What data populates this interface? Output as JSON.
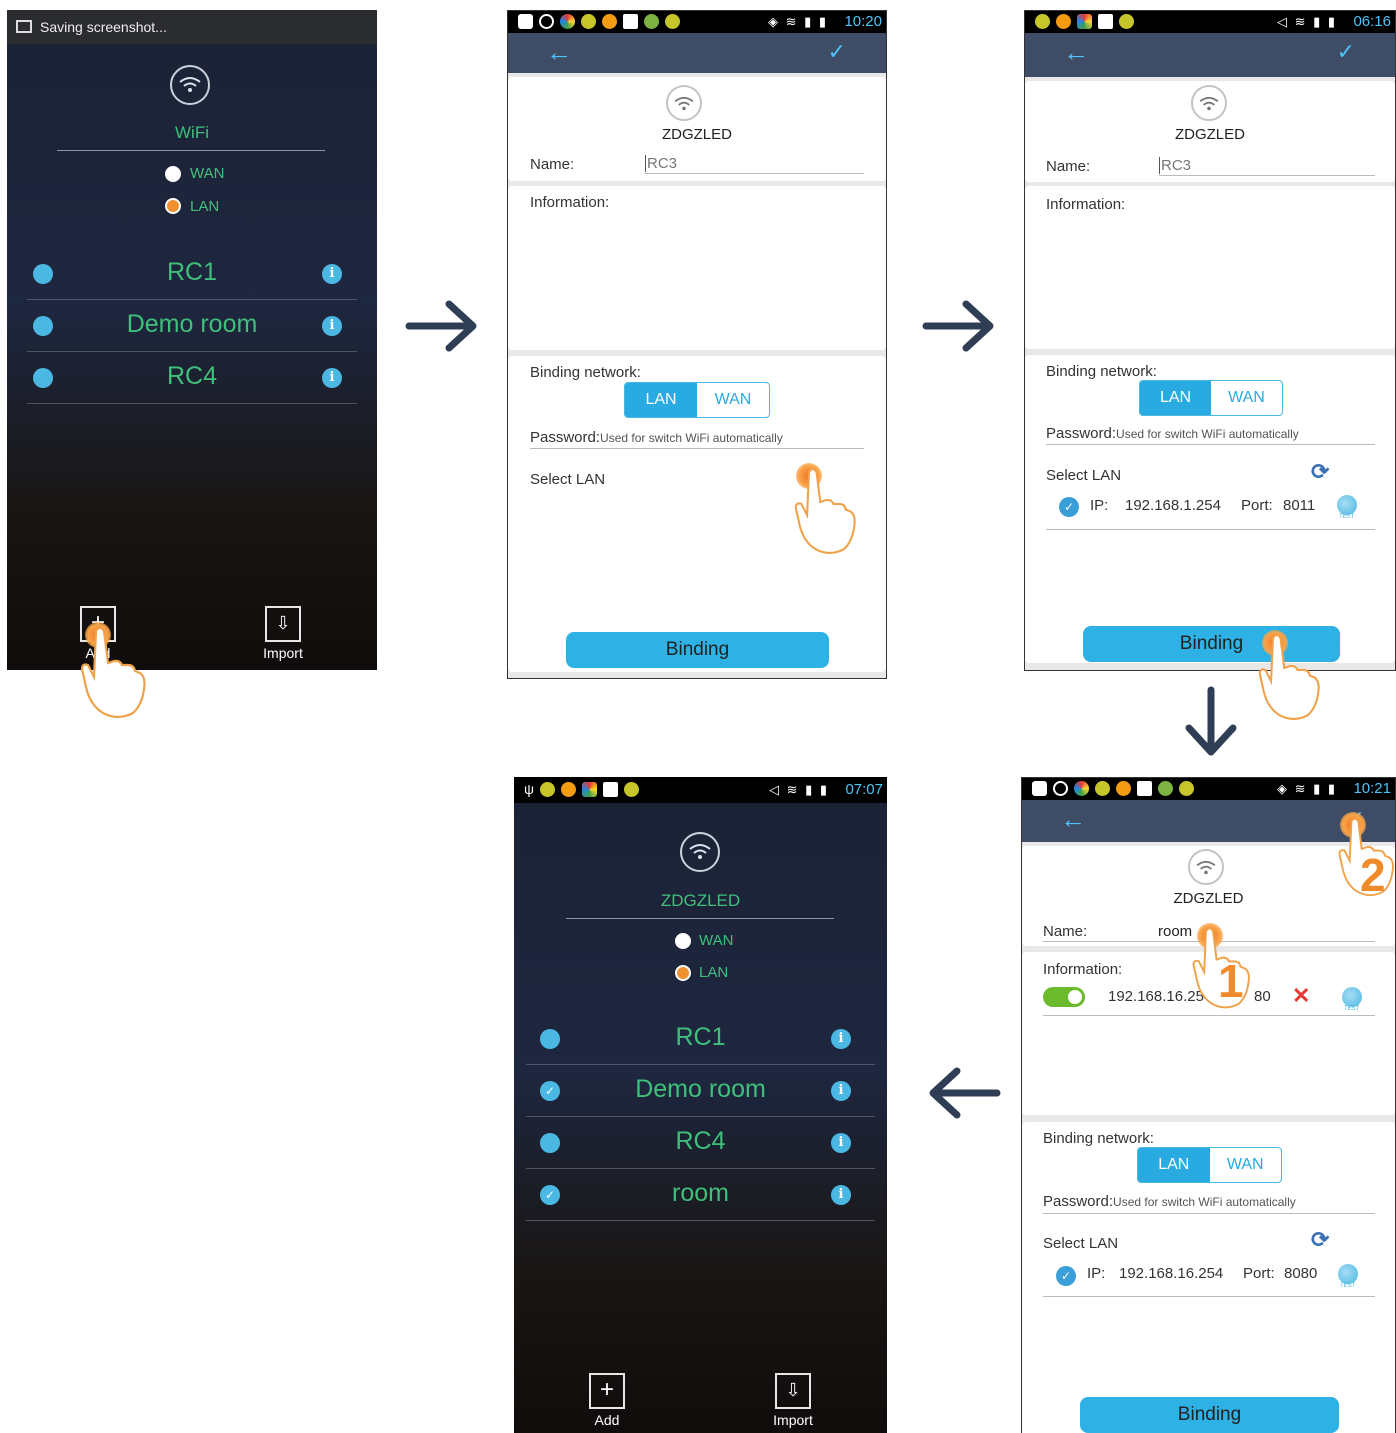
{
  "screen1": {
    "notification": "Saving screenshot...",
    "brand": "WiFi",
    "radio_wan": "WAN",
    "radio_lan": "LAN",
    "rows": [
      "RC1",
      "Demo room",
      "RC4"
    ],
    "add_label": "Add",
    "import_label": "Import"
  },
  "screen2": {
    "time": "10:20",
    "device": "ZDGZLED",
    "name_label": "Name:",
    "name_value": "RC3",
    "information_label": "Information:",
    "binding_network_label": "Binding network:",
    "seg_lan": "LAN",
    "seg_wan": "WAN",
    "password_label": "Password:",
    "password_hint": "Used for switch WiFi automatically",
    "select_lan_label": "Select LAN",
    "binding_button": "Binding"
  },
  "screen3": {
    "time": "06:16",
    "device": "ZDGZLED",
    "name_label": "Name:",
    "name_value": "RC3",
    "information_label": "Information:",
    "binding_network_label": "Binding network:",
    "seg_lan": "LAN",
    "seg_wan": "WAN",
    "password_label": "Password:",
    "password_hint": "Used for switch WiFi automatically",
    "select_lan_label": "Select LAN",
    "ip_label": "IP:",
    "ip_value": "192.168.1.254",
    "port_label": "Port:",
    "port_value": "8011",
    "binding_button": "Binding"
  },
  "screen4": {
    "time": "10:21",
    "device": "ZDGZLED",
    "name_label": "Name:",
    "name_value": "room",
    "information_label": "Information:",
    "info_ip": "192.168.16.254",
    "info_port": "80",
    "binding_network_label": "Binding network:",
    "seg_lan": "LAN",
    "seg_wan": "WAN",
    "password_label": "Password:",
    "password_hint": "Used for switch WiFi automatically",
    "select_lan_label": "Select LAN",
    "ip_label": "IP:",
    "ip_value": "192.168.16.254",
    "port_label": "Port:",
    "port_value": "8080",
    "binding_button": "Binding",
    "step1": "1",
    "step2": "2"
  },
  "screen5": {
    "time": "07:07",
    "brand": "ZDGZLED",
    "radio_wan": "WAN",
    "radio_lan": "LAN",
    "rows": [
      "RC1",
      "Demo room",
      "RC4",
      "room"
    ],
    "add_label": "Add",
    "import_label": "Import"
  },
  "icons": {
    "wifi": "wifi-icon",
    "info": "info-icon",
    "check": "check-icon",
    "back": "back-arrow-icon",
    "confirm": "checkmark-icon",
    "refresh": "refresh-icon",
    "globe": "globe-test-icon",
    "hand": "hand-pointer-icon",
    "flow_arrow": "flow-arrow-icon"
  },
  "colors": {
    "accent": "#29aae1",
    "brand_green": "#3ec07b",
    "titlebar": "#3f4c66",
    "tap_orange": "#f37022",
    "flow_arrow": "#2f3e54"
  }
}
